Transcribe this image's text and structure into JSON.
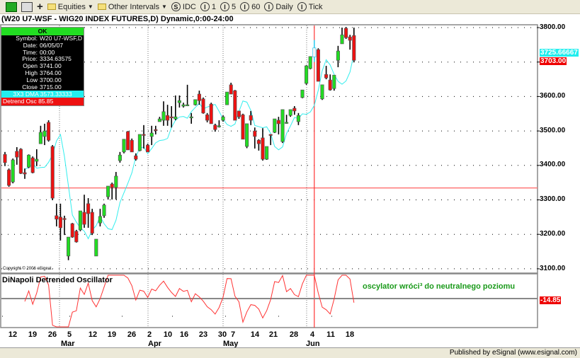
{
  "toolbar": {
    "equities": "Equities",
    "other_intervals": "Other Intervals",
    "intervals": [
      {
        "icon": "S",
        "label": "IDC"
      },
      {
        "icon": "I",
        "label": "1"
      },
      {
        "icon": "I",
        "label": "5"
      },
      {
        "icon": "I",
        "label": "60"
      },
      {
        "icon": "I",
        "label": "Daily"
      },
      {
        "icon": "I",
        "label": "Tick"
      }
    ]
  },
  "chart": {
    "title": "(W20 U7-WSF - WIG20 INDEX FUTURES,D) Dynamic,0:00-24:00",
    "copyright": "Copyright © 2006 eSignal.",
    "price_labels": [
      "3800.00",
      "3600.00",
      "3500.00",
      "3400.00",
      "3300.00",
      "3200.00",
      "3100.00"
    ],
    "dma_label": "3725.66667",
    "last_label": "3703.00",
    "crosshair_price": 3334.63575,
    "crosshair_bar": 78,
    "colors": {
      "up": "#22dd22",
      "down": "#ee1111",
      "dma": "#33eeee",
      "osc": "#ff3333",
      "crosshair": "#ff3333"
    }
  },
  "data_window": {
    "status": "OK",
    "rows": [
      {
        "k": "Symbol:",
        "v": "W20 U7-WSF,D"
      },
      {
        "k": "Date:",
        "v": "06/05/07"
      },
      {
        "k": "Time:",
        "v": "00:00"
      },
      {
        "k": "Price:",
        "v": "3334.63575"
      },
      {
        "k": "Open",
        "v": "3741.00"
      },
      {
        "k": "High",
        "v": "3764.00"
      },
      {
        "k": "Low",
        "v": "3700.00"
      },
      {
        "k": "Close",
        "v": "3715.00"
      }
    ],
    "dma": "3X3 DMA  3573.33333",
    "osc": "Detrend Osc  85.85"
  },
  "oscillator": {
    "title": "DiNapoli Detrended Oscillator",
    "annotation": "oscylator wróci³ do neutralnego poziomu",
    "value_label": "-14.85"
  },
  "x_axis": {
    "days": [
      "12",
      "19",
      "26",
      "5",
      "12",
      "19",
      "26",
      "2",
      "10",
      "16",
      "23",
      "30",
      "7",
      "14",
      "21",
      "28",
      "4",
      "11",
      "18"
    ],
    "months": [
      "Mar",
      "Apr",
      "May",
      "Jun"
    ]
  },
  "status_bar": "Published by eSignal (www.esignal.com)",
  "chart_data": {
    "type": "candlestick",
    "ylim": [
      3080,
      3820
    ],
    "ohlc": [
      [
        3432,
        3439,
        3398,
        3408
      ],
      [
        3387,
        3391,
        3338,
        3342
      ],
      [
        3352,
        3420,
        3348,
        3416
      ],
      [
        3441,
        3453,
        3402,
        3424
      ],
      [
        3447,
        3450,
        3375,
        3377
      ],
      [
        3379,
        3391,
        3361,
        3375
      ],
      [
        3395,
        3432,
        3392,
        3430
      ],
      [
        3422,
        3426,
        3377,
        3379
      ],
      [
        3412,
        3447,
        3398,
        3418
      ],
      [
        3463,
        3515,
        3463,
        3496
      ],
      [
        3484,
        3521,
        3459,
        3500
      ],
      [
        3525,
        3531,
        3469,
        3473
      ],
      [
        3455,
        3459,
        3299,
        3305
      ],
      [
        3254,
        3289,
        3223,
        3244
      ],
      [
        3250,
        3289,
        3182,
        3219
      ],
      [
        3246,
        3254,
        3198,
        3244
      ],
      [
        3137,
        3192,
        3125,
        3192
      ],
      [
        3231,
        3233,
        3190,
        3192
      ],
      [
        3209,
        3213,
        3176,
        3178
      ],
      [
        3213,
        3268,
        3209,
        3268
      ],
      [
        3264,
        3315,
        3219,
        3229
      ],
      [
        3289,
        3305,
        3219,
        3260
      ],
      [
        3264,
        3274,
        3198,
        3203
      ],
      [
        3137,
        3186,
        3137,
        3186
      ],
      [
        3233,
        3274,
        3223,
        3252
      ],
      [
        3254,
        3289,
        3248,
        3285
      ],
      [
        3309,
        3340,
        3301,
        3340
      ],
      [
        3346,
        3350,
        3301,
        3336
      ],
      [
        3336,
        3381,
        3301,
        3369
      ],
      [
        3414,
        3439,
        3408,
        3430
      ],
      [
        3439,
        3476,
        3435,
        3476
      ],
      [
        3498,
        3500,
        3445,
        3445
      ],
      [
        3473,
        3478,
        3439,
        3439
      ],
      [
        3428,
        3435,
        3414,
        3418
      ],
      [
        3443,
        3490,
        3441,
        3490
      ],
      [
        3490,
        3517,
        3449,
        3488
      ],
      [
        3459,
        3463,
        3439,
        3439
      ],
      [
        3484,
        3515,
        3459,
        3494
      ],
      [
        3504,
        3515,
        3490,
        3502
      ],
      [
        3527,
        3541,
        3527,
        3535
      ],
      [
        3531,
        3586,
        3515,
        3556
      ],
      [
        3545,
        3576,
        3515,
        3531
      ],
      [
        3541,
        3572,
        3510,
        3539
      ],
      [
        3535,
        3603,
        3531,
        3541
      ],
      [
        3582,
        3603,
        3568,
        3588
      ],
      [
        3572,
        3582,
        3568,
        3576
      ],
      [
        3576,
        3634,
        3572,
        3576
      ],
      [
        3541,
        3552,
        3521,
        3541
      ],
      [
        3576,
        3591,
        3574,
        3591
      ],
      [
        3607,
        3617,
        3576,
        3588
      ],
      [
        3593,
        3597,
        3550,
        3552
      ],
      [
        3547,
        3552,
        3525,
        3531
      ],
      [
        3578,
        3582,
        3521,
        3521
      ],
      [
        3517,
        3521,
        3498,
        3504
      ],
      [
        3515,
        3531,
        3510,
        3515
      ],
      [
        3531,
        3545,
        3527,
        3541
      ],
      [
        3576,
        3613,
        3576,
        3613
      ],
      [
        3634,
        3640,
        3607,
        3607
      ],
      [
        3617,
        3619,
        3531,
        3531
      ],
      [
        3558,
        3558,
        3535,
        3541
      ],
      [
        3547,
        3550,
        3476,
        3476
      ],
      [
        3455,
        3521,
        3450,
        3521
      ],
      [
        3545,
        3558,
        3517,
        3531
      ],
      [
        3500,
        3510,
        3449,
        3484
      ],
      [
        3473,
        3476,
        3443,
        3463
      ],
      [
        3480,
        3508,
        3414,
        3418
      ],
      [
        3418,
        3455,
        3416,
        3455
      ],
      [
        3490,
        3490,
        3459,
        3488
      ],
      [
        3496,
        3535,
        3494,
        3535
      ],
      [
        3531,
        3541,
        3490,
        3521
      ],
      [
        3469,
        3562,
        3465,
        3562
      ],
      [
        3525,
        3547,
        3521,
        3525
      ],
      [
        3545,
        3562,
        3541,
        3562
      ],
      [
        3566,
        3572,
        3547,
        3558
      ],
      [
        3527,
        3552,
        3517,
        3545
      ],
      [
        3597,
        3619,
        3595,
        3619
      ],
      [
        3638,
        3691,
        3634,
        3689
      ],
      [
        3681,
        3716,
        3679,
        3716
      ],
      [
        3741,
        3764,
        3700,
        3715
      ],
      [
        3736,
        3740,
        3644,
        3644
      ],
      [
        3593,
        3634,
        3590,
        3634
      ],
      [
        3664,
        3689,
        3650,
        3654
      ],
      [
        3648,
        3664,
        3617,
        3619
      ],
      [
        3623,
        3662,
        3617,
        3662
      ],
      [
        3705,
        3747,
        3685,
        3732
      ],
      [
        3753,
        3800,
        3753,
        3779
      ],
      [
        3798,
        3802,
        3767,
        3771
      ],
      [
        3773,
        3779,
        3736,
        3763
      ],
      [
        3777,
        3800,
        3699,
        3705
      ]
    ]
  }
}
